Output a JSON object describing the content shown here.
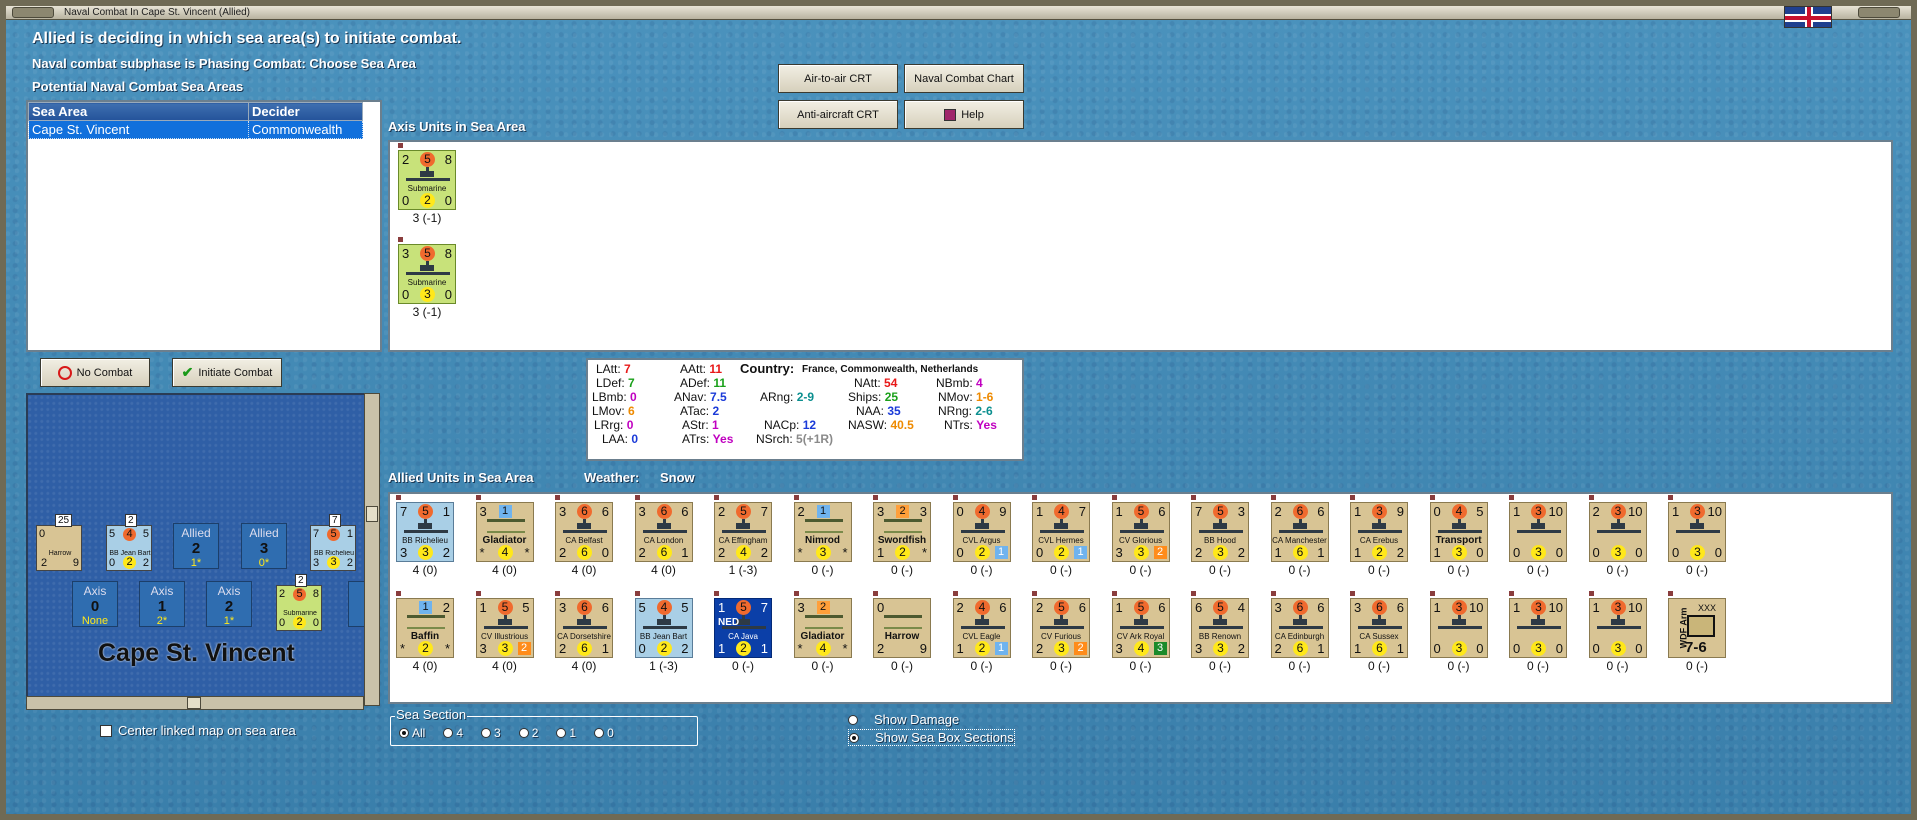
{
  "window": {
    "title": "Naval Combat In Cape St. Vincent (Allied)"
  },
  "header": {
    "line1": "Allied is deciding in which sea area(s) to initiate combat.",
    "line2": "Naval combat subphase is Phasing Combat: Choose Sea Area",
    "line3": "Potential Naval Combat Sea Areas"
  },
  "sea_table": {
    "headers": [
      "Sea Area",
      "Decider"
    ],
    "rows": [
      [
        "Cape St. Vincent",
        "Commonwealth"
      ]
    ]
  },
  "buttons": {
    "air_to_air": "Air-to-air CRT",
    "naval_chart": "Naval Combat Chart",
    "anti_aircraft": "Anti-aircraft CRT",
    "help": "Help",
    "no_combat": "No Combat",
    "initiate": "Initiate Combat"
  },
  "axis_section": {
    "title": "Axis Units in Sea Area"
  },
  "axis_units": [
    {
      "tl": "2",
      "circ": "5",
      "tr": "8",
      "name": "Submarine",
      "bl": "0",
      "yc": "2",
      "br": "0",
      "caption": "3 (-1)"
    },
    {
      "tl": "3",
      "circ": "5",
      "tr": "8",
      "name": "Submarine",
      "bl": "0",
      "yc": "3",
      "br": "0",
      "caption": "3 (-1)"
    }
  ],
  "stats": {
    "country_label": "Country:",
    "country_value": "France, Commonwealth, Netherlands",
    "LAtt": "7",
    "LDef": "7",
    "LBmb": "0",
    "LMov": "6",
    "LRrg": "0",
    "LAA": "0",
    "AAtt": "11",
    "ADef": "11",
    "ANav": "7.5",
    "ATac": "2",
    "AStr": "1",
    "ATrs": "Yes",
    "ARng": "2-9",
    "NACp": "12",
    "NSrch": "5(+1R)",
    "NAtt": "54",
    "Ships": "25",
    "NAA": "35",
    "NASW": "40.5",
    "NBmb": "4",
    "NMov": "1-6",
    "NRng": "2-6",
    "NTrs": "Yes"
  },
  "allied_section": {
    "title": "Allied Units in Sea Area",
    "weather_label": "Weather:",
    "weather_value": "Snow"
  },
  "allied_row1": [
    {
      "kind": "fr",
      "tl": "7",
      "circ": "5",
      "tr": "1",
      "name": "BB Richelieu",
      "bl": "3",
      "yc": "3",
      "br": "2",
      "caption": "4 (0)"
    },
    {
      "kind": "air",
      "tl": "3",
      "sq": "1",
      "tr": "",
      "name": "Gladiator",
      "bl": "*",
      "yc": "4",
      "br": "*",
      "caption": "4 (0)",
      "big": true
    },
    {
      "kind": "ship",
      "tl": "3",
      "circ": "6",
      "tr": "6",
      "name": "CA Belfast",
      "bl": "2",
      "yc": "6",
      "br": "0",
      "caption": "4 (0)"
    },
    {
      "kind": "ship",
      "tl": "3",
      "circ": "6",
      "tr": "6",
      "name": "CA London",
      "bl": "2",
      "yc": "6",
      "br": "1",
      "caption": "4 (0)"
    },
    {
      "kind": "ship",
      "tl": "2",
      "circ": "5",
      "tr": "7",
      "name": "CA Effingham",
      "bl": "2",
      "yc": "4",
      "br": "2",
      "caption": "1 (-3)"
    },
    {
      "kind": "air",
      "tl": "2",
      "sq": "1",
      "tr": "",
      "name": "Nimrod",
      "bl": "*",
      "yc": "3",
      "br": "*",
      "caption": "0 (-)",
      "big": true
    },
    {
      "kind": "air",
      "tl": "3",
      "sq": "2",
      "sqor": true,
      "tr": "3",
      "name": "Swordfish",
      "bl": "1",
      "yc": "2",
      "br": "*",
      "caption": "0 (-)",
      "big": true
    },
    {
      "kind": "ship",
      "tl": "0",
      "circ": "4",
      "tr": "9",
      "name": "CVL Argus",
      "bl": "0",
      "yc": "2",
      "br": "1",
      "bsq": "#6fb3ee",
      "caption": "0 (-)"
    },
    {
      "kind": "ship",
      "tl": "1",
      "circ": "4",
      "tr": "7",
      "name": "CVL Hermes",
      "bl": "0",
      "yc": "2",
      "br": "1",
      "bsq": "#6fb3ee",
      "caption": "0 (-)"
    },
    {
      "kind": "ship",
      "tl": "1",
      "circ": "5",
      "tr": "6",
      "name": "CV Glorious",
      "bl": "3",
      "yc": "3",
      "br": "2",
      "bsq": "#ff8c1a",
      "caption": "0 (-)"
    },
    {
      "kind": "ship",
      "tl": "7",
      "circ": "5",
      "tr": "3",
      "name": "BB Hood",
      "bl": "2",
      "yc": "3",
      "br": "2",
      "caption": "0 (-)"
    },
    {
      "kind": "ship",
      "tl": "2",
      "circ": "6",
      "tr": "6",
      "name": "CA Manchester",
      "bl": "1",
      "yc": "6",
      "br": "1",
      "caption": "0 (-)"
    },
    {
      "kind": "ship",
      "tl": "1",
      "circ": "3",
      "tr": "9",
      "name": "CA Erebus",
      "bl": "1",
      "yc": "2",
      "br": "2",
      "caption": "0 (-)"
    },
    {
      "kind": "ship",
      "tl": "0",
      "circ": "4",
      "tr": "5",
      "name": "Transport",
      "bl": "1",
      "yc": "3",
      "br": "0",
      "caption": "0 (-)",
      "big": true
    },
    {
      "kind": "conv",
      "tl": "1",
      "circ": "3",
      "tr": "10",
      "name": "",
      "bl": "0",
      "yc": "3",
      "br": "0",
      "caption": "0 (-)"
    },
    {
      "kind": "conv",
      "tl": "2",
      "circ": "3",
      "tr": "10",
      "name": "",
      "bl": "0",
      "yc": "3",
      "br": "0",
      "caption": "0 (-)"
    },
    {
      "kind": "conv",
      "tl": "1",
      "circ": "3",
      "tr": "10",
      "name": "",
      "bl": "0",
      "yc": "3",
      "br": "0",
      "caption": "0 (-)"
    }
  ],
  "allied_row2": [
    {
      "kind": "air",
      "tl": "",
      "sq": "1",
      "tr": "2",
      "name": "Baffin",
      "bl": "*",
      "yc": "2",
      "br": "*",
      "caption": "4 (0)",
      "big": true
    },
    {
      "kind": "ship",
      "tl": "1",
      "circ": "5",
      "tr": "5",
      "name": "CV Illustrious",
      "bl": "3",
      "yc": "3",
      "br": "2",
      "bsq": "#ff8c1a",
      "caption": "4 (0)"
    },
    {
      "kind": "ship",
      "tl": "3",
      "circ": "6",
      "tr": "6",
      "name": "CA Dorsetshire",
      "bl": "2",
      "yc": "6",
      "br": "1",
      "caption": "4 (0)"
    },
    {
      "kind": "fr",
      "tl": "5",
      "circ": "4",
      "tr": "5",
      "name": "BB Jean Bart",
      "bl": "0",
      "yc": "2",
      "br": "2",
      "caption": "1 (-3)"
    },
    {
      "kind": "ned",
      "tl": "1",
      "circ": "5",
      "tr": "7",
      "name": "CA Java",
      "bl": "1",
      "yc": "2",
      "br": "1",
      "caption": "0 (-)",
      "flag": "NED"
    },
    {
      "kind": "air",
      "tl": "3",
      "sq": "2",
      "sqor": true,
      "tr": "",
      "name": "Gladiator",
      "bl": "*",
      "yc": "4",
      "br": "*",
      "caption": "0 (-)",
      "big": true
    },
    {
      "kind": "air",
      "tl": "0",
      "sq": "",
      "tr": "",
      "name": "Harrow",
      "bl": "2",
      "yc": "",
      "br": "9",
      "caption": "0 (-)",
      "big": true
    },
    {
      "kind": "ship",
      "tl": "2",
      "circ": "4",
      "tr": "6",
      "name": "CVL Eagle",
      "bl": "1",
      "yc": "2",
      "br": "1",
      "bsq": "#6fb3ee",
      "caption": "0 (-)"
    },
    {
      "kind": "ship",
      "tl": "2",
      "circ": "5",
      "tr": "6",
      "name": "CV Furious",
      "bl": "2",
      "yc": "3",
      "br": "2",
      "bsq": "#ff8c1a",
      "caption": "0 (-)"
    },
    {
      "kind": "ship",
      "tl": "1",
      "circ": "5",
      "tr": "6",
      "name": "CV Ark Royal",
      "bl": "3",
      "yc": "4",
      "br": "3",
      "bsq": "#1b8a2a",
      "caption": "0 (-)"
    },
    {
      "kind": "ship",
      "tl": "6",
      "circ": "5",
      "tr": "4",
      "name": "BB Renown",
      "bl": "3",
      "yc": "3",
      "br": "2",
      "caption": "0 (-)"
    },
    {
      "kind": "ship",
      "tl": "3",
      "circ": "6",
      "tr": "6",
      "name": "CA Edinburgh",
      "bl": "2",
      "yc": "6",
      "br": "1",
      "caption": "0 (-)"
    },
    {
      "kind": "ship",
      "tl": "3",
      "circ": "6",
      "tr": "6",
      "name": "CA Sussex",
      "bl": "1",
      "yc": "6",
      "br": "1",
      "caption": "0 (-)"
    },
    {
      "kind": "conv",
      "tl": "1",
      "circ": "3",
      "tr": "10",
      "name": "",
      "bl": "0",
      "yc": "3",
      "br": "0",
      "caption": "0 (-)"
    },
    {
      "kind": "conv",
      "tl": "1",
      "circ": "3",
      "tr": "10",
      "name": "",
      "bl": "0",
      "yc": "3",
      "br": "0",
      "caption": "0 (-)"
    },
    {
      "kind": "conv",
      "tl": "1",
      "circ": "3",
      "tr": "10",
      "name": "",
      "bl": "0",
      "yc": "3",
      "br": "0",
      "caption": "0 (-)"
    },
    {
      "kind": "army",
      "tl": "",
      "circ": "",
      "tr": "",
      "name": "XXX",
      "bl": "",
      "yc": "",
      "br": "",
      "caption": "0 (-)",
      "side": "WDF Arm",
      "val": "7-6"
    }
  ],
  "map": {
    "name": "Cape St. Vincent",
    "allied_boxes": [
      {
        "label": "Allied",
        "value": "2",
        "sub": "1*"
      },
      {
        "label": "Allied",
        "value": "3",
        "sub": "0*"
      }
    ],
    "axis_boxes": [
      {
        "label": "Axis",
        "value": "0",
        "sub": "None"
      },
      {
        "label": "Axis",
        "value": "1",
        "sub": "2*"
      },
      {
        "label": "Axis",
        "value": "2",
        "sub": "1*"
      },
      {
        "label": "A",
        "value": "",
        "sub": ""
      }
    ],
    "tokens": [
      {
        "top": "25",
        "name": "Harrow",
        "tl": "0",
        "br": "9",
        "b": "2"
      },
      {
        "top": "2",
        "name": "BB Jean Bart",
        "tl": "5",
        "c": "4",
        "tr": "5",
        "bl": "0",
        "yc": "2",
        "br": "2"
      },
      {
        "top": "7",
        "name": "BB Richelieu",
        "tl": "7",
        "c": "5",
        "tr": "1",
        "bl": "3",
        "yc": "3",
        "br": "2"
      },
      {
        "top": "2",
        "name": "Submarine",
        "tl": "2",
        "c": "5",
        "tr": "8",
        "bl": "0",
        "yc": "2",
        "br": "0"
      }
    ]
  },
  "center_map_label": "Center linked map on sea area",
  "sea_section": {
    "title": "Sea Section",
    "options": [
      "All",
      "4",
      "3",
      "2",
      "1",
      "0"
    ],
    "selected": "All"
  },
  "display_options": {
    "show_damage": "Show Damage",
    "show_sea_box": "Show Sea Box Sections"
  }
}
